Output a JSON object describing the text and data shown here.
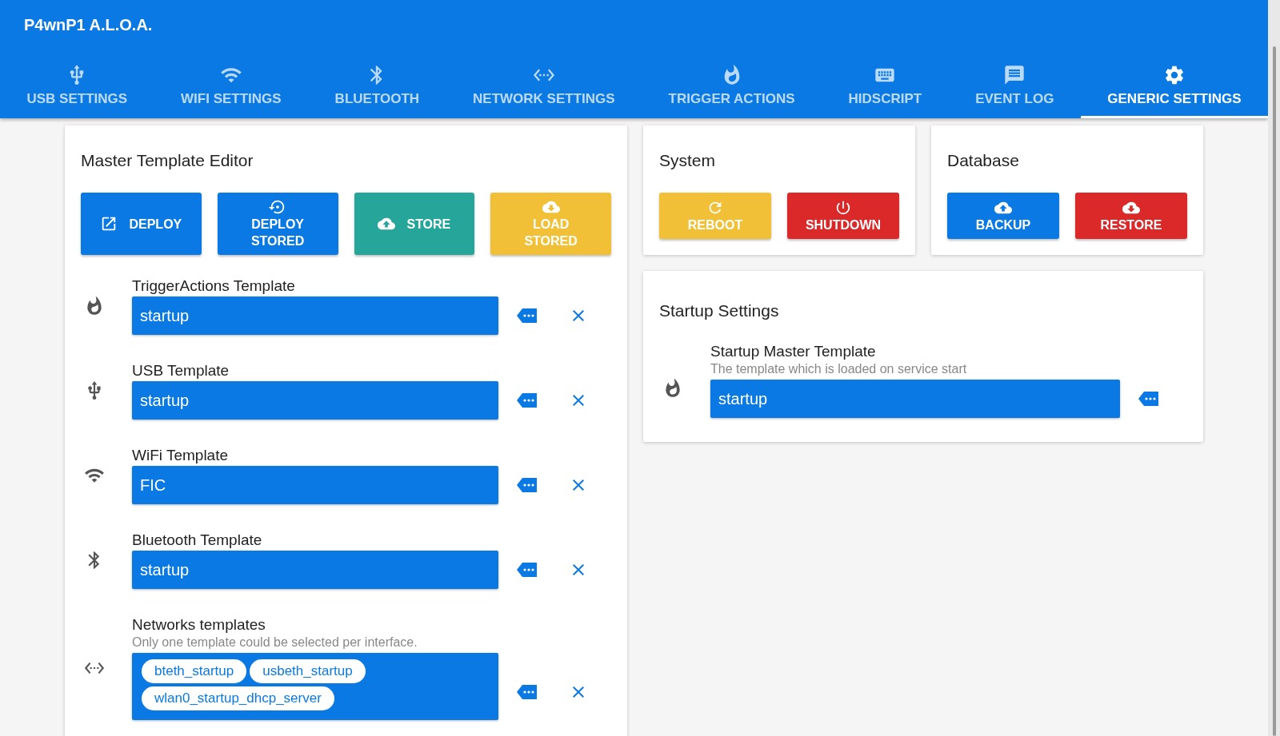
{
  "app_title": "P4wnP1 A.L.O.A.",
  "tabs": [
    {
      "label": "USB SETTINGS",
      "selected": false
    },
    {
      "label": "WIFI SETTINGS",
      "selected": false
    },
    {
      "label": "BLUETOOTH",
      "selected": false
    },
    {
      "label": "NETWORK SETTINGS",
      "selected": false
    },
    {
      "label": "TRIGGER ACTIONS",
      "selected": false
    },
    {
      "label": "HIDSCRIPT",
      "selected": false
    },
    {
      "label": "EVENT LOG",
      "selected": false
    },
    {
      "label": "GENERIC SETTINGS",
      "selected": true
    }
  ],
  "master_template_editor": {
    "title": "Master Template Editor",
    "buttons": [
      {
        "label": "DEPLOY",
        "color": "#0b79e3",
        "kind": "inline"
      },
      {
        "label": "DEPLOY STORED",
        "color": "#0b79e3",
        "kind": "stacked"
      },
      {
        "label": "STORE",
        "color": "#26a69a",
        "kind": "inline"
      },
      {
        "label": "LOAD STORED",
        "color": "#f2c037",
        "kind": "stacked"
      }
    ],
    "rows": [
      {
        "label": "TriggerActions Template",
        "kind": "single",
        "value": "startup"
      },
      {
        "label": "USB Template",
        "kind": "single",
        "value": "startup"
      },
      {
        "label": "WiFi Template",
        "kind": "single",
        "value": "FIC"
      },
      {
        "label": "Bluetooth Template",
        "kind": "single",
        "value": "startup"
      },
      {
        "label": "Networks templates",
        "kind": "multi",
        "hint": "Only one template could be selected per interface.",
        "chips": [
          "bteth_startup",
          "usbeth_startup",
          "wlan0_startup_dhcp_server"
        ]
      }
    ]
  },
  "system": {
    "title": "System",
    "buttons": [
      {
        "label": "REBOOT",
        "color": "#f2c037"
      },
      {
        "label": "SHUTDOWN",
        "color": "#db2828"
      }
    ]
  },
  "database": {
    "title": "Database",
    "buttons": [
      {
        "label": "BACKUP",
        "color": "#0b79e3"
      },
      {
        "label": "RESTORE",
        "color": "#db2828"
      }
    ]
  },
  "startup_settings": {
    "title": "Startup Settings",
    "label": "Startup Master Template",
    "hint": "The template which is loaded on service start",
    "value": "startup"
  }
}
